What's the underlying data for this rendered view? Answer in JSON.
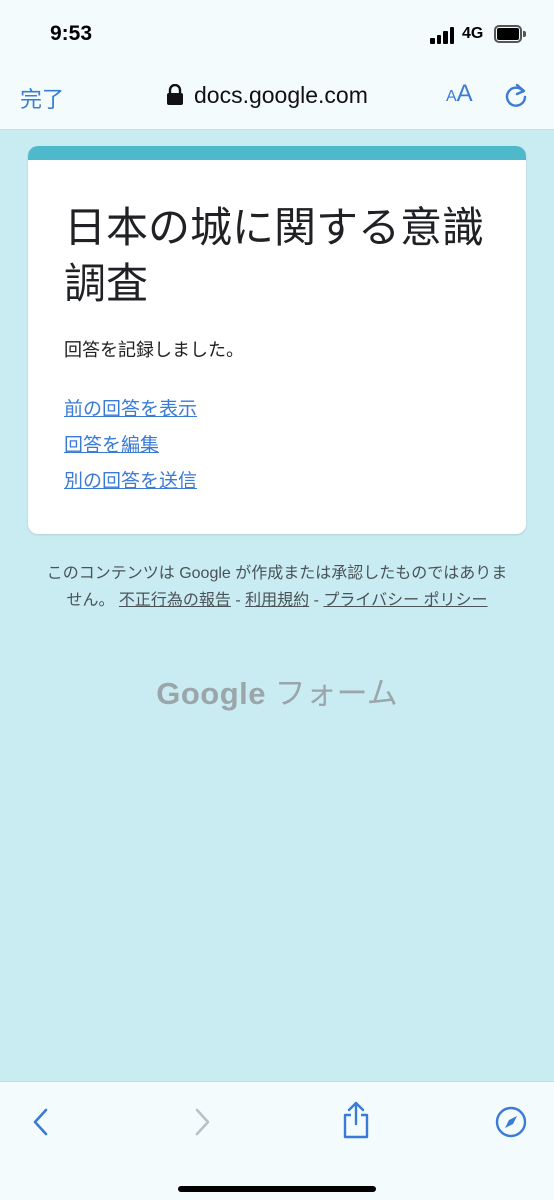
{
  "status": {
    "time": "9:53",
    "network": "4G"
  },
  "browser": {
    "done_label": "完了",
    "url": "docs.google.com",
    "text_size_small": "A",
    "text_size_large": "A"
  },
  "form": {
    "title": "日本の城に関する意識調査",
    "confirmation": "回答を記録しました。",
    "links": [
      {
        "label": "前の回答を表示"
      },
      {
        "label": "回答を編集"
      },
      {
        "label": "別の回答を送信"
      }
    ]
  },
  "footer": {
    "disclaimer": "このコンテンツは Google が作成または承認したものではありません。",
    "report_abuse": "不正行為の報告",
    "separator": " - ",
    "terms": "利用規約",
    "privacy": "プライバシー ポリシー",
    "logo_google": "Google",
    "logo_forms": "フォーム"
  },
  "colors": {
    "background": "#c9ebf2",
    "accent": "#4fb9cc",
    "link": "#3a7bd5"
  },
  "icons": {
    "back": "chevron-left-icon",
    "forward": "chevron-right-icon",
    "share": "share-icon",
    "safari": "compass-icon",
    "lock": "lock-icon",
    "reload": "reload-icon"
  }
}
